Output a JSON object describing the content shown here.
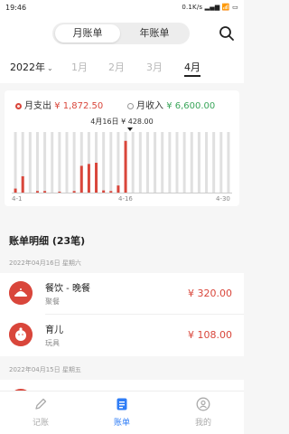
{
  "status": {
    "time": "19:46",
    "right": "0.1K/s ▂▄▆ 📶 ▭"
  },
  "header": {
    "segments": [
      "月账单",
      "年账单"
    ],
    "active_segment": 0
  },
  "months": {
    "year": "2022年",
    "items": [
      "1月",
      "2月",
      "3月",
      "4月"
    ],
    "active": 3
  },
  "summary": {
    "expense_label": "月支出",
    "expense_amount": "¥ 1,872.50",
    "income_label": "月收入",
    "income_amount": "¥ 6,600.00",
    "tooltip": "4月16日 ¥ 428.00"
  },
  "chart_data": {
    "type": "bar",
    "x_labels": [
      "4-1",
      "4-16",
      "4-30"
    ],
    "categories": [
      "4-1",
      "4-2",
      "4-3",
      "4-4",
      "4-5",
      "4-6",
      "4-7",
      "4-8",
      "4-9",
      "4-10",
      "4-11",
      "4-12",
      "4-13",
      "4-14",
      "4-15",
      "4-16",
      "4-17",
      "4-18",
      "4-19",
      "4-20",
      "4-21",
      "4-22",
      "4-23",
      "4-24",
      "4-25",
      "4-26",
      "4-27",
      "4-28",
      "4-29",
      "4-30"
    ],
    "values": [
      40,
      140,
      0,
      20,
      20,
      0,
      10,
      0,
      20,
      225,
      240,
      250,
      25,
      20,
      65,
      428,
      0,
      0,
      0,
      0,
      0,
      0,
      0,
      0,
      0,
      0,
      0,
      0,
      0,
      0
    ],
    "highlight_index": 15,
    "ylim": [
      0,
      500
    ],
    "colors": {
      "value": "#d9463b",
      "background": "#e0e0e0"
    }
  },
  "list": {
    "title": "账单明细 (23笔)",
    "groups": [
      {
        "date": "2022年04月16日 星期六",
        "records": [
          {
            "name": "餐饮 - 晚餐",
            "sub": "聚餐",
            "amount": "¥ 320.00",
            "icon": "dining-icon"
          },
          {
            "name": "育儿",
            "sub": "玩具",
            "amount": "¥ 108.00",
            "icon": "baby-icon"
          }
        ]
      },
      {
        "date": "2022年04月15日 星期五",
        "records": []
      }
    ]
  },
  "tabs": [
    {
      "label": "记账",
      "icon": "pencil-icon"
    },
    {
      "label": "账单",
      "icon": "bill-icon"
    },
    {
      "label": "我的",
      "icon": "profile-icon"
    }
  ],
  "active_tab": 1,
  "colors": {
    "accent": "#2f7df6",
    "expense": "#d9463b",
    "income": "#3aa65a"
  }
}
